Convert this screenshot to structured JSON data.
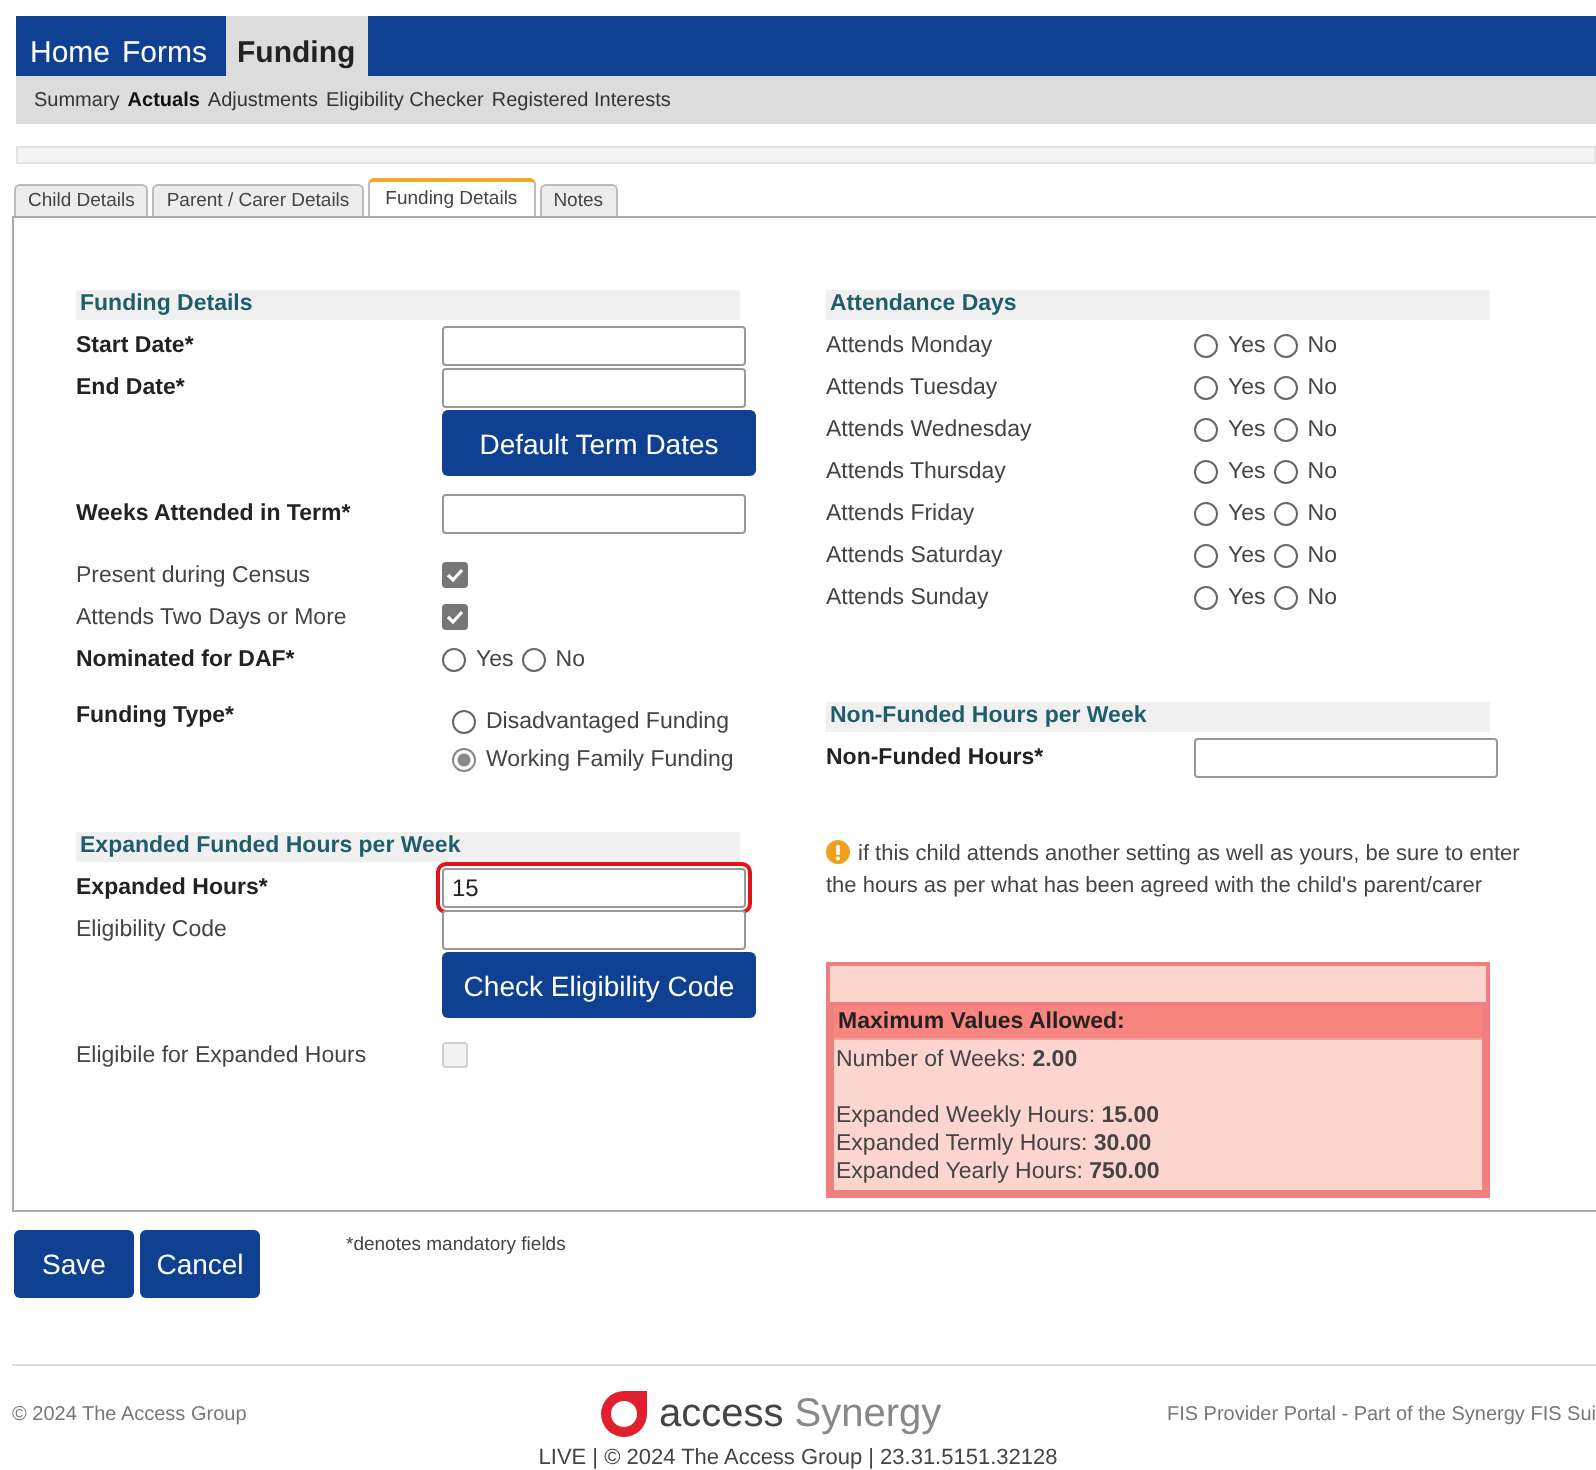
{
  "nav": {
    "tabs": [
      {
        "label": "Home",
        "selected": false
      },
      {
        "label": "Forms",
        "selected": false
      },
      {
        "label": "Funding",
        "selected": true
      }
    ],
    "subtabs": [
      {
        "label": "Summary",
        "selected": false
      },
      {
        "label": "Actuals",
        "selected": true
      },
      {
        "label": "Adjustments",
        "selected": false
      },
      {
        "label": "Eligibility Checker",
        "selected": false
      },
      {
        "label": "Registered Interests",
        "selected": false
      }
    ]
  },
  "tabs": [
    {
      "label": "Child Details",
      "selected": false
    },
    {
      "label": "Parent / Carer Details",
      "selected": false
    },
    {
      "label": "Funding Details",
      "selected": true
    },
    {
      "label": "Notes",
      "selected": false
    }
  ],
  "columns": [
    {
      "sections": [
        {
          "kind": "form",
          "title": "Funding Details",
          "items": [
            {
              "kind": "input",
              "label": "Start Date*",
              "required": true
            },
            {
              "kind": "input",
              "label": "End Date*",
              "required": true
            },
            {
              "kind": "button",
              "label": "Default Term Dates"
            },
            {
              "kind": "input",
              "label": "Weeks Attended in Term*",
              "required": true
            },
            {
              "kind": "checkbox",
              "label": "Present during Census",
              "required": false,
              "checked": true,
              "disabled": false
            },
            {
              "kind": "checkbox",
              "label": "Attends Two Days or More",
              "required": false,
              "checked": true,
              "disabled": false
            },
            {
              "kind": "radio",
              "label": "Nominated for DAF*",
              "required": true,
              "options": [
                {
                  "label": "Yes",
                  "selected": false
                },
                {
                  "label": "No",
                  "selected": false
                }
              ]
            },
            {
              "kind": "radio_stack",
              "label": "Funding Type*",
              "required": true,
              "options": [
                {
                  "label": "Disadvantaged Funding",
                  "selected": false
                },
                {
                  "label": "Working Family Funding",
                  "selected": true
                }
              ]
            }
          ]
        },
        {
          "kind": "form",
          "title": "Expanded Funded Hours per Week",
          "items": [
            {
              "kind": "input",
              "label": "Expanded Hours*",
              "required": true,
              "value": "15",
              "highlighted": true
            },
            {
              "kind": "input",
              "label": "Eligibility Code",
              "required": false
            },
            {
              "kind": "button",
              "label": "Check Eligibility Code"
            },
            {
              "kind": "checkbox",
              "label": "Eligibile for Expanded Hours",
              "required": false,
              "checked": false,
              "disabled": true
            }
          ]
        }
      ]
    },
    {
      "sections": [
        {
          "kind": "form",
          "title": "Attendance Days",
          "items": [
            {
              "kind": "radio",
              "label": "Attends Monday",
              "required": false,
              "options": [
                {
                  "label": "Yes",
                  "selected": false
                },
                {
                  "label": "No",
                  "selected": false
                }
              ]
            },
            {
              "kind": "radio",
              "label": "Attends Tuesday",
              "required": false,
              "options": [
                {
                  "label": "Yes",
                  "selected": false
                },
                {
                  "label": "No",
                  "selected": false
                }
              ]
            },
            {
              "kind": "radio",
              "label": "Attends Wednesday",
              "required": false,
              "options": [
                {
                  "label": "Yes",
                  "selected": false
                },
                {
                  "label": "No",
                  "selected": false
                }
              ]
            },
            {
              "kind": "radio",
              "label": "Attends Thursday",
              "required": false,
              "options": [
                {
                  "label": "Yes",
                  "selected": false
                },
                {
                  "label": "No",
                  "selected": false
                }
              ]
            },
            {
              "kind": "radio",
              "label": "Attends Friday",
              "required": false,
              "options": [
                {
                  "label": "Yes",
                  "selected": false
                },
                {
                  "label": "No",
                  "selected": false
                }
              ]
            },
            {
              "kind": "radio",
              "label": "Attends Saturday",
              "required": false,
              "options": [
                {
                  "label": "Yes",
                  "selected": false
                },
                {
                  "label": "No",
                  "selected": false
                }
              ]
            },
            {
              "kind": "radio",
              "label": "Attends Sunday",
              "required": false,
              "options": [
                {
                  "label": "Yes",
                  "selected": false
                },
                {
                  "label": "No",
                  "selected": false
                }
              ]
            }
          ]
        },
        {
          "kind": "form",
          "title": "Non-Funded Hours per Week",
          "items": [
            {
              "kind": "input",
              "label": "Non-Funded Hours*",
              "required": true
            }
          ]
        },
        {
          "kind": "note",
          "text": "if this child attends another setting as well as yours, be sure to enter the hours as per what has been agreed with the child's parent/carer"
        },
        {
          "kind": "limits",
          "title": "Maximum Values Allowed:",
          "groups": [
            [
              "Number of Weeks: **2.00**"
            ],
            [
              "Expanded Weekly Hours: **15.00**",
              "Expanded Termly Hours: **30.00**",
              "Expanded Yearly Hours: **750.00**"
            ]
          ]
        }
      ]
    }
  ],
  "actions": [
    "Save",
    "Cancel"
  ],
  "mandatory_note": "*denotes mandatory fields",
  "footer": {
    "copyright": "© 2024 The Access Group",
    "logo": {
      "word": "access",
      "suffix": "Synergy"
    },
    "portal": "FIS Provider Portal - Part of the Synergy FIS Sui",
    "build": "LIVE | © 2024 The Access Group | 23.31.5151.32128"
  }
}
